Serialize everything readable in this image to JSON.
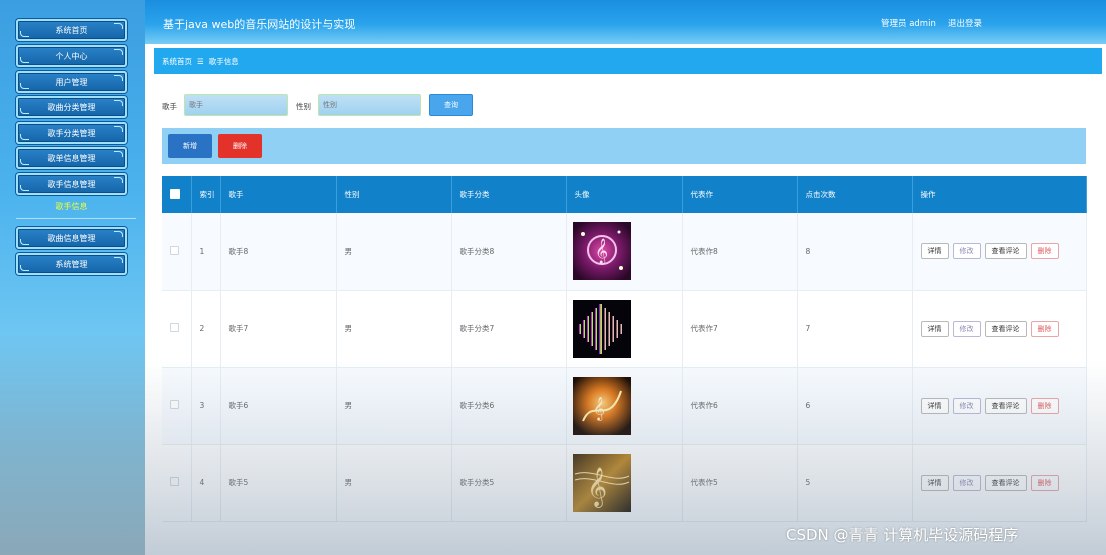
{
  "app": {
    "title": "基于java web的音乐网站的设计与实现",
    "user_label": "管理员 admin",
    "logout_label": "退出登录"
  },
  "sidebar": {
    "items": [
      {
        "label": "系统首页"
      },
      {
        "label": "个人中心"
      },
      {
        "label": "用户管理"
      },
      {
        "label": "歌曲分类管理"
      },
      {
        "label": "歌手分类管理"
      },
      {
        "label": "歌单信息管理"
      },
      {
        "label": "歌手信息管理"
      },
      {
        "label": "歌曲信息管理"
      },
      {
        "label": "系统管理"
      }
    ],
    "active_sub": "歌手信息"
  },
  "breadcrumb": {
    "home": "系统首页",
    "separator": "☰",
    "current": "歌手信息"
  },
  "search": {
    "singer_label": "歌手",
    "singer_placeholder": "歌手",
    "gender_label": "性别",
    "gender_placeholder": "性别",
    "query_button": "查询"
  },
  "actions": {
    "add": "新增",
    "delete": "删除"
  },
  "table": {
    "headers": [
      "",
      "索引",
      "歌手",
      "性别",
      "歌手分类",
      "头像",
      "代表作",
      "点击次数",
      "操作"
    ],
    "rows": [
      {
        "index": "1",
        "singer": "歌手8",
        "gender": "男",
        "category": "歌手分类8",
        "work": "代表作8",
        "clicks": "8"
      },
      {
        "index": "2",
        "singer": "歌手7",
        "gender": "男",
        "category": "歌手分类7",
        "work": "代表作7",
        "clicks": "7"
      },
      {
        "index": "3",
        "singer": "歌手6",
        "gender": "男",
        "category": "歌手分类6",
        "work": "代表作6",
        "clicks": "6"
      },
      {
        "index": "4",
        "singer": "歌手5",
        "gender": "男",
        "category": "歌手分类5",
        "work": "代表作5",
        "clicks": "5"
      }
    ],
    "ops": {
      "detail": "详情",
      "edit": "修改",
      "comments": "查看评论",
      "remove": "删除"
    }
  },
  "watermark": "CSDN @青青  计算机毕设源码程序",
  "colors": {
    "header": "#1a8ee0",
    "breadcrumb": "#22a8ee",
    "table_header": "#1181c9",
    "add_button": "#2a73c4",
    "delete_button": "#e2322a",
    "active_sub": "#e8ff3a"
  }
}
